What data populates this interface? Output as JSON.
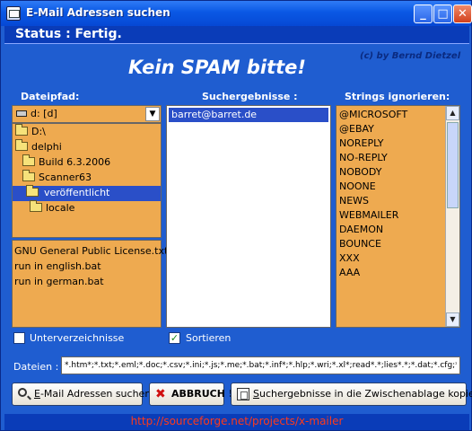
{
  "window": {
    "title": "E-Mail Adressen suchen",
    "controls": [
      "_",
      "□",
      "✕"
    ]
  },
  "status": {
    "text": "Status : Fertig."
  },
  "slogan": "Kein SPAM bitte!",
  "credit": "(c) by Bernd Dietzel",
  "left": {
    "heading": "Dateipfad:",
    "drive": "d: [d]",
    "tree": [
      "D:\\",
      "delphi",
      "Build 6.3.2006",
      "Scanner63",
      "veröffentlicht",
      "locale"
    ],
    "files": [
      "GNU General Public License.txt",
      "run in english.bat",
      "run in german.bat"
    ]
  },
  "middle": {
    "heading": "Suchergebnisse :",
    "results": [
      "barret@barret.de"
    ]
  },
  "right": {
    "heading": "Strings ignorieren:",
    "items": [
      "@MICROSOFT",
      "@EBAY",
      "NOREPLY",
      "NO-REPLY",
      "NOBODY",
      "NOONE",
      "NEWS",
      "WEBMAILER",
      "DAEMON",
      "BOUNCE",
      "XXX",
      "AAA"
    ]
  },
  "options": {
    "subdirs_label": "Unterverzeichnisse",
    "subdirs_checked": false,
    "sort_label": "Sortieren",
    "sort_checked": true
  },
  "files_field": {
    "label": "Dateien :",
    "value": "*.htm*;*.txt;*.eml;*.doc;*.csv;*.ini;*.js;*.me;*.bat;*.inf*;*.hlp;*.wri;*.xl*;read*.*;lies*.*;*.dat;*.cfg;*."
  },
  "buttons": {
    "search": {
      "prefix": "E",
      "rest": "-Mail Adressen suchen"
    },
    "abort": "ABBRUCH !",
    "copy": {
      "prefix": "S",
      "rest": "uchergebnisse in die  Zwischenablage kopieren"
    }
  },
  "footer": {
    "link": "http://sourceforge.net/projects/x-mailer"
  },
  "colors": {
    "background": "#1f5dd0",
    "panel": "#eeaa50",
    "selection": "#2a4fc8",
    "link": "#ff3a1a"
  }
}
